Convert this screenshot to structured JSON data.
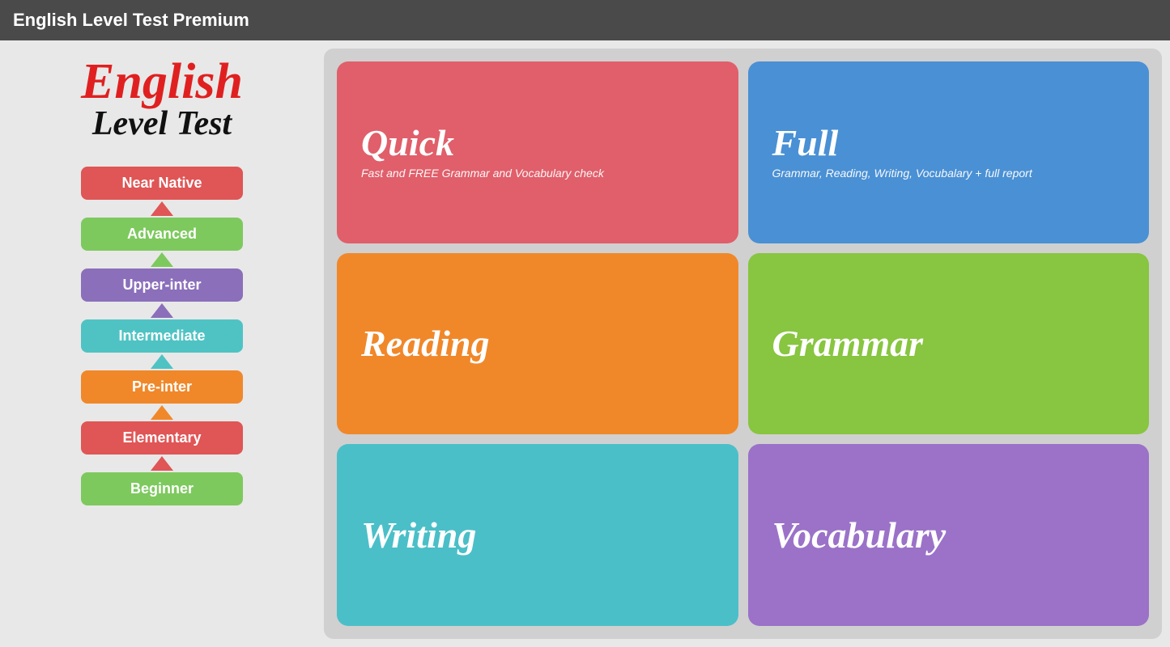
{
  "app": {
    "title": "English Level Test Premium"
  },
  "logo": {
    "line1": "English",
    "line2": "Level Test"
  },
  "levels": [
    {
      "label": "Near Native",
      "class": "level-near-native",
      "arrow": "arrow-red"
    },
    {
      "label": "Advanced",
      "class": "level-advanced",
      "arrow": "arrow-green"
    },
    {
      "label": "Upper-inter",
      "class": "level-upper-inter",
      "arrow": "arrow-purple"
    },
    {
      "label": "Intermediate",
      "class": "level-intermediate",
      "arrow": "arrow-cyan"
    },
    {
      "label": "Pre-inter",
      "class": "level-pre-inter",
      "arrow": "arrow-orange"
    },
    {
      "label": "Elementary",
      "class": "level-elementary",
      "arrow": "arrow-red"
    },
    {
      "label": "Beginner",
      "class": "level-beginner",
      "arrow": null
    }
  ],
  "tests": [
    {
      "id": "quick",
      "title": "Quick",
      "subtitle": "Fast and FREE Grammar and Vocabulary check",
      "class": "btn-quick",
      "has_subtitle": true
    },
    {
      "id": "full",
      "title": "Full",
      "subtitle": "Grammar, Reading, Writing, Vocubalary + full report",
      "class": "btn-full",
      "has_subtitle": true
    },
    {
      "id": "reading",
      "title": "Reading",
      "subtitle": "",
      "class": "btn-reading",
      "has_subtitle": false
    },
    {
      "id": "grammar",
      "title": "Grammar",
      "subtitle": "",
      "class": "btn-grammar",
      "has_subtitle": false
    },
    {
      "id": "writing",
      "title": "Writing",
      "subtitle": "",
      "class": "btn-writing",
      "has_subtitle": false
    },
    {
      "id": "vocabulary",
      "title": "Vocabulary",
      "subtitle": "",
      "class": "btn-vocabulary",
      "has_subtitle": false
    }
  ]
}
